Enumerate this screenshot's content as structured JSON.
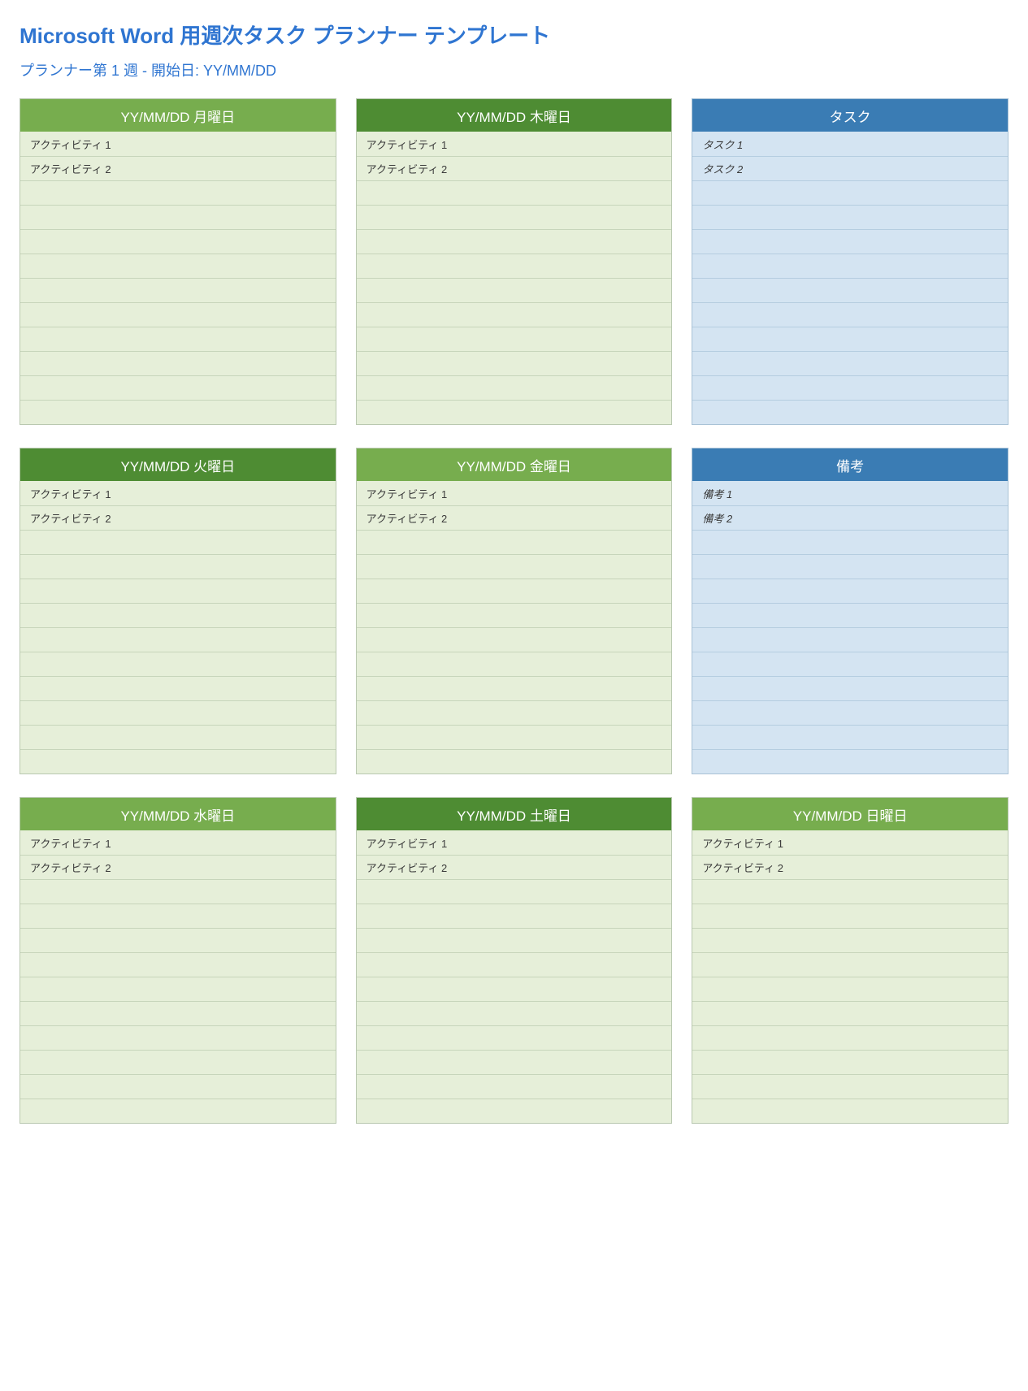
{
  "title": "Microsoft Word 用週次タスク プランナー テンプレート",
  "subtitle": "プランナー第 1 週 - 開始日: YY/MM/DD",
  "rows_per_card": 12,
  "cards": [
    {
      "id": "mon",
      "header": "YY/MM/DD 月曜日",
      "theme": "green-light",
      "items": [
        "アクティビティ 1",
        "アクティビティ 2"
      ]
    },
    {
      "id": "thu",
      "header": "YY/MM/DD 木曜日",
      "theme": "green-dark",
      "items": [
        "アクティビティ 1",
        "アクティビティ 2"
      ]
    },
    {
      "id": "tasks",
      "header": "タスク",
      "theme": "blue",
      "items": [
        "タスク 1",
        "タスク 2"
      ]
    },
    {
      "id": "tue",
      "header": "YY/MM/DD 火曜日",
      "theme": "green-dark",
      "items": [
        "アクティビティ 1",
        "アクティビティ 2"
      ]
    },
    {
      "id": "fri",
      "header": "YY/MM/DD 金曜日",
      "theme": "green-light",
      "items": [
        "アクティビティ 1",
        "アクティビティ 2"
      ]
    },
    {
      "id": "notes",
      "header": "備考",
      "theme": "blue",
      "items": [
        "備考 1",
        "備考 2"
      ]
    },
    {
      "id": "wed",
      "header": "YY/MM/DD 水曜日",
      "theme": "green-light",
      "items": [
        "アクティビティ 1",
        "アクティビティ 2"
      ]
    },
    {
      "id": "sat",
      "header": "YY/MM/DD 土曜日",
      "theme": "green-dark",
      "items": [
        "アクティビティ 1",
        "アクティビティ 2"
      ]
    },
    {
      "id": "sun",
      "header": "YY/MM/DD 日曜日",
      "theme": "green-light",
      "items": [
        "アクティビティ 1",
        "アクティビティ 2"
      ]
    }
  ]
}
